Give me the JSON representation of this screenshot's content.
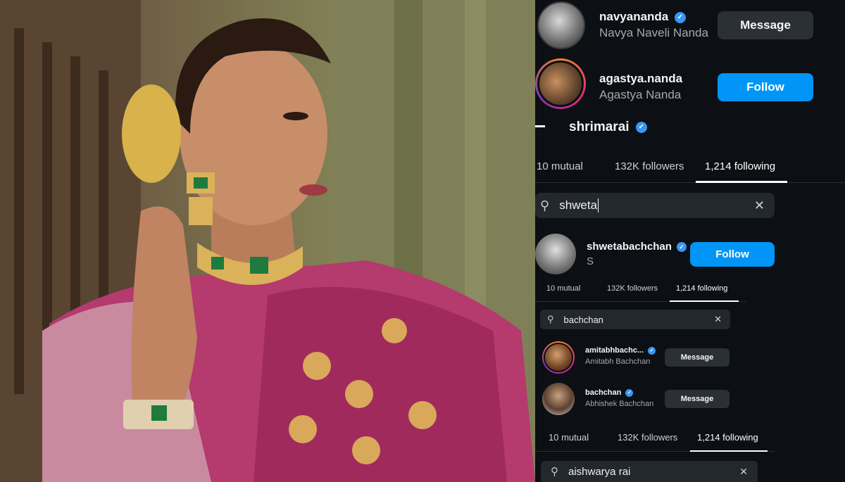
{
  "colors": {
    "accent": "#0095f6",
    "verified": "#3897f0",
    "panel_bg": "#0c0f14",
    "search_bg": "#23272e"
  },
  "photo": {
    "description_icon": "portrait-photo"
  },
  "top_list": [
    {
      "username": "navyananda",
      "full_name": "Navya Naveli Nanda",
      "button": "Message",
      "verified": true
    },
    {
      "username": "agastya.nanda",
      "full_name": "Agastya Nanda",
      "button": "Follow",
      "verified": false
    }
  ],
  "profile1": {
    "back_icon": "back-arrow-icon",
    "username": "shrimarai",
    "tabs": [
      "10 mutual",
      "132K followers",
      "1,214 following"
    ],
    "search_value": "shweta"
  },
  "result1": {
    "username": "shwetabachchan",
    "full_name": "S",
    "button": "Follow"
  },
  "profile2": {
    "tabs": [
      "10 mutual",
      "132K followers",
      "1,214 following"
    ],
    "search_value": "bachchan",
    "results": [
      {
        "username": "amitabhbachc...",
        "full_name": "Amitabh Bachchan",
        "button": "Message"
      },
      {
        "username": "bachchan",
        "full_name": "Abhishek Bachchan",
        "button": "Message"
      }
    ]
  },
  "profile3": {
    "tabs": [
      "10 mutual",
      "132K followers",
      "1,214 following"
    ],
    "search_value": "aishwarya rai"
  }
}
